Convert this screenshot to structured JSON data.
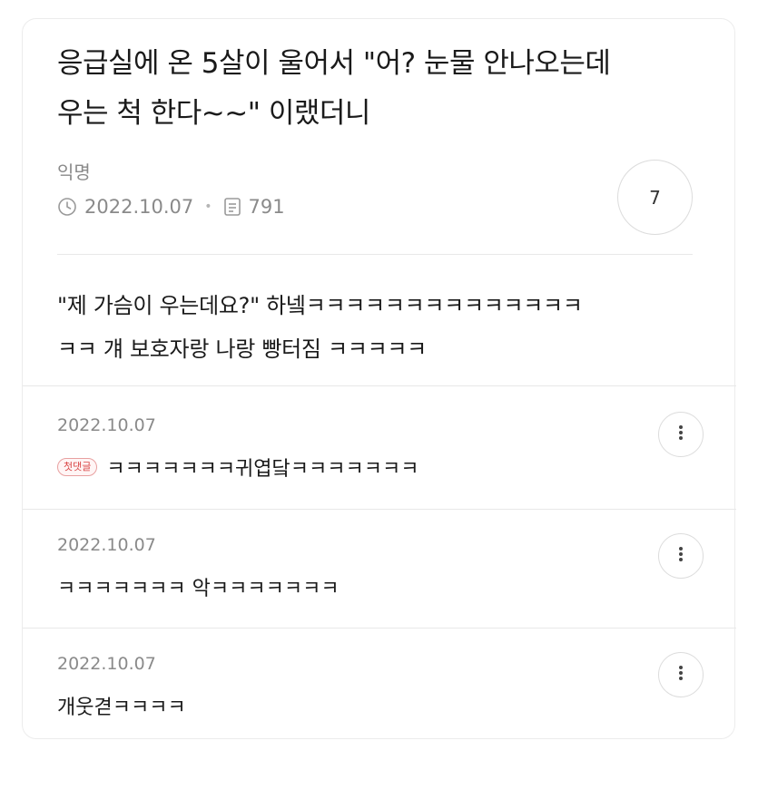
{
  "post": {
    "title_line1": "응급실에 온 5살이 울어서 \"어? 눈물 안나오는데",
    "title_line2": "우는 척 한다~~\" 이랬더니",
    "author": "익명",
    "date": "2022.10.07",
    "views": "791",
    "comment_count": "7",
    "body_line1": "\"제 가슴이 우는데요?\" 하넼ㅋㅋㅋㅋㅋㅋㅋㅋㅋㅋㅋㅋㅋㅋ",
    "body_line2": "ㅋㅋ 걔 보호자랑 나랑 빵터짐 ㅋㅋㅋㅋㅋ"
  },
  "comments": [
    {
      "date": "2022.10.07",
      "badge": "첫댓글",
      "text": "ㅋㅋㅋㅋㅋㅋㅋ귀엽닼ㅋㅋㅋㅋㅋㅋㅋ"
    },
    {
      "date": "2022.10.07",
      "text": "ㅋㅋㅋㅋㅋㅋㅋ 악ㅋㅋㅋㅋㅋㅋㅋ"
    },
    {
      "date": "2022.10.07",
      "text": "개웃겯ㅋㅋㅋㅋ"
    }
  ],
  "icons": {
    "date": "clock-icon",
    "views": "document-icon",
    "more": "more-vertical-icon"
  }
}
